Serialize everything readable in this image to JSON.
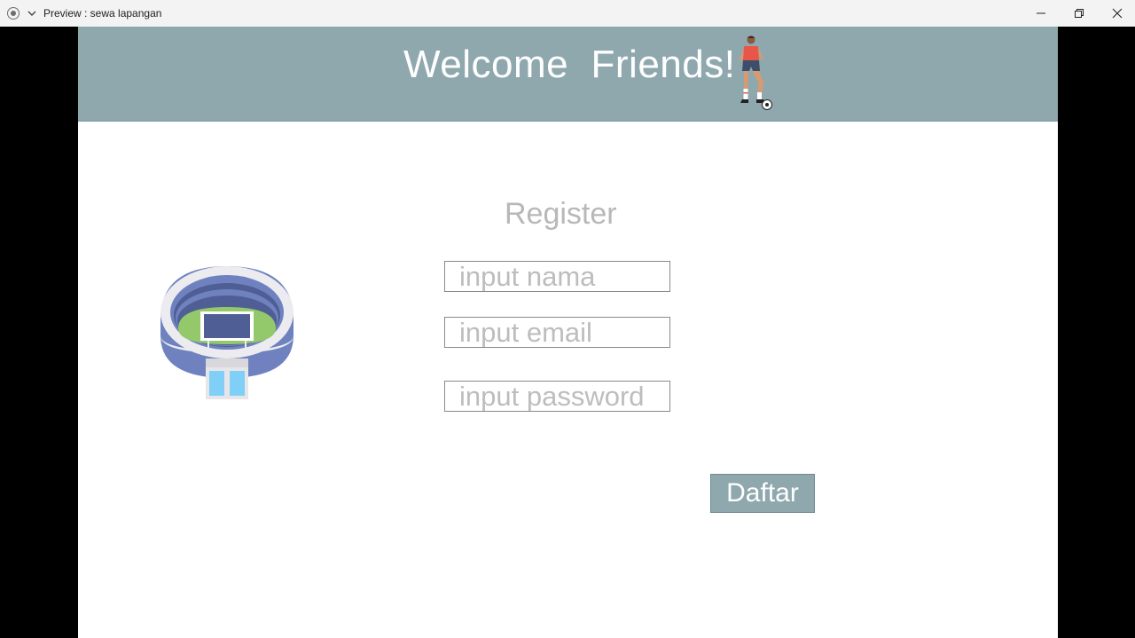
{
  "window": {
    "title": "Preview : sewa lapangan",
    "icons": [
      "app-record-icon",
      "chevron-down-icon",
      "minimize-icon",
      "restore-icon",
      "close-icon"
    ]
  },
  "header": {
    "welcome_text": "Welcome  Friends!",
    "background_color": "#8fa8ae",
    "image": "football-player-illustration"
  },
  "form": {
    "title": "Register",
    "fields": [
      {
        "name": "nama",
        "placeholder": "input nama",
        "value": ""
      },
      {
        "name": "email",
        "placeholder": "input email",
        "value": ""
      },
      {
        "name": "password",
        "placeholder": "input password",
        "value": ""
      }
    ],
    "submit_label": "Daftar",
    "side_image": "stadium-illustration"
  },
  "colors": {
    "accent": "#8fa8ae",
    "placeholder_text": "#bdbdbd",
    "title_text": "#b8b8b8"
  }
}
